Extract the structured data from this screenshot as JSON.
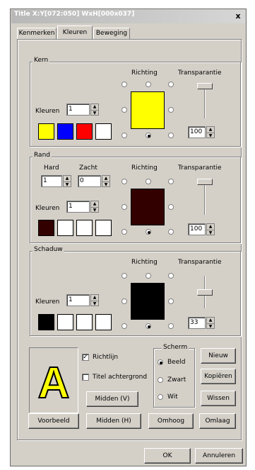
{
  "window": {
    "title": "Title  X:Y[072:050] WxH[000x037]",
    "close_label": "x"
  },
  "tabs": [
    {
      "label": "Kenmerken"
    },
    {
      "label": "Kleuren"
    },
    {
      "label": "Beweging"
    }
  ],
  "kern": {
    "title": "Kern",
    "richting_label": "Richting",
    "transparantie_label": "Transparantie",
    "kleuren_label": "Kleuren",
    "kleuren_value": "1",
    "transparantie_value": "100",
    "transparantie_level": 1.0,
    "preview_color": "#ffff00",
    "swatches": [
      "#ffff00",
      "#0000ff",
      "#ff0000",
      "#ffffff"
    ],
    "selected_direction": "bottom-center"
  },
  "rand": {
    "title": "Rand",
    "hard_label": "Hard",
    "zacht_label": "Zacht",
    "hard_value": "1",
    "zacht_value": "0",
    "richting_label": "Richting",
    "transparantie_label": "Transparantie",
    "kleuren_label": "Kleuren",
    "kleuren_value": "1",
    "transparantie_value": "100",
    "transparantie_level": 1.0,
    "preview_color": "#330000",
    "swatches": [
      "#330000",
      "#ffffff",
      "#ffffff",
      "#ffffff"
    ],
    "selected_direction": "bottom-center"
  },
  "schaduw": {
    "title": "Schaduw",
    "richting_label": "Richting",
    "transparantie_label": "Transparantie",
    "kleuren_label": "Kleuren",
    "kleuren_value": "1",
    "transparantie_value": "33",
    "transparantie_level": 0.33,
    "preview_color": "#000000",
    "swatches": [
      "#000000",
      "#ffffff",
      "#ffffff",
      "#ffffff"
    ],
    "selected_direction": "bottom-center"
  },
  "bottom": {
    "preview_letter": "A",
    "richtlijn_label": "Richtlijn",
    "richtlijn_checked": true,
    "titel_achtergrond_label": "Titel achtergrond",
    "titel_achtergrond_checked": false,
    "scherm_title": "Scherm",
    "scherm_options": [
      "Beeld",
      "Zwart",
      "Wit"
    ],
    "scherm_selected": "Beeld",
    "nieuw_label": "Nieuw",
    "kopieren_label": "Kopiëren",
    "wissen_label": "Wissen",
    "midden_v_label": "Midden (V)",
    "midden_h_label": "Midden (H)",
    "voorbeeld_label": "Voorbeeld",
    "omhoog_label": "Omhoog",
    "omlaag_label": "Omlaag",
    "ok_label": "OK",
    "annuleren_label": "Annuleren"
  },
  "colors": {
    "text_outline": "#000000"
  }
}
